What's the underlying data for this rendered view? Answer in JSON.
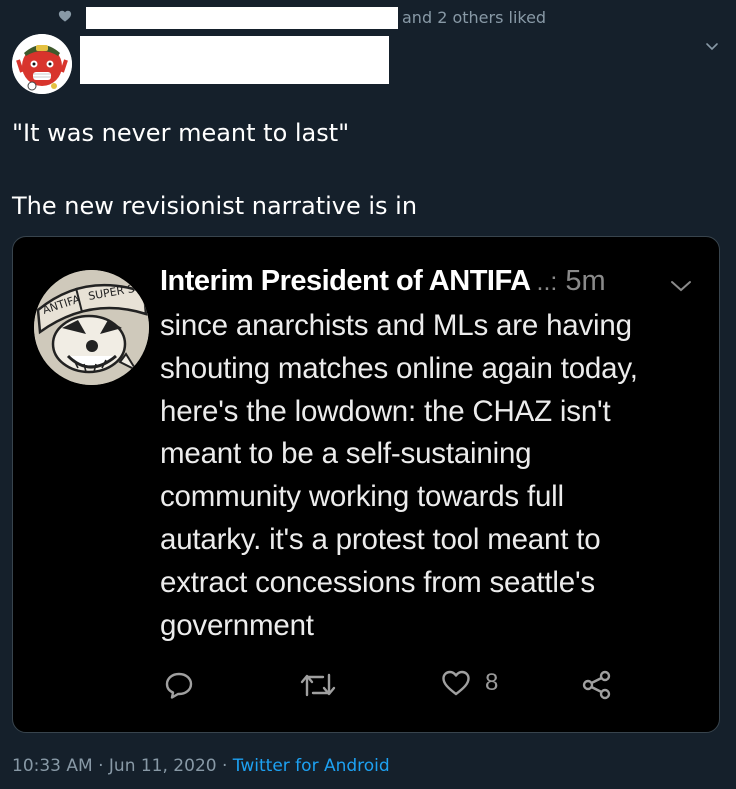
{
  "social_context": {
    "liked_text": "and 2 others liked"
  },
  "tweet": {
    "lines": [
      "\"It was never meant to last\"",
      "The new revisionist narrative is in"
    ],
    "timestamp": "10:33 AM · Jun 11, 2020 · ",
    "source": "Twitter for Android"
  },
  "quoted_tweet": {
    "name": "Interim President of ANTIFA",
    "dots": "..:",
    "time": "5m",
    "body_lines": [
      "since anarchists and MLs are having",
      "shouting matches online again today,",
      "here's the lowdown: the CHAZ isn't",
      "meant to be a self-sustaining",
      "community working towards full",
      "autarky. it's a protest tool meant to",
      "extract concessions from seattle's",
      "government"
    ],
    "like_count": "8",
    "avatar_patch_text": "ANTIFA SUPER SOLDIER"
  },
  "icons": {
    "heart": "heart-icon",
    "caret": "chevron-down-icon",
    "reply": "reply-icon",
    "retweet": "retweet-icon",
    "like": "like-icon",
    "share": "share-icon"
  },
  "colors": {
    "background": "#15202b",
    "card": "#000000",
    "secondary_text": "#8899a6",
    "link": "#1da1f2"
  }
}
